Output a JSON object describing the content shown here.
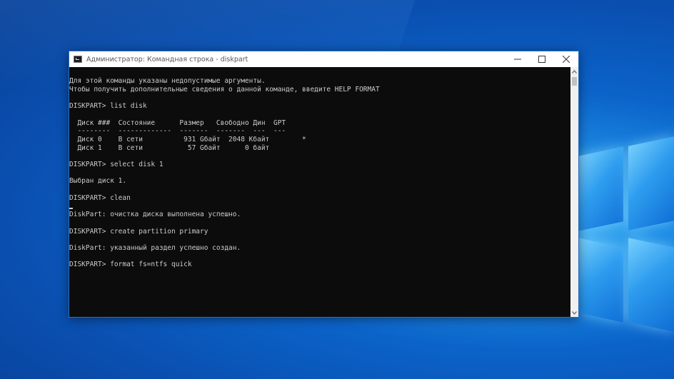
{
  "window": {
    "title": "Администратор: Командная строка - diskpart",
    "controls": {
      "minimize": "minimize-icon",
      "maximize": "maximize-icon",
      "close": "close-icon"
    }
  },
  "console": {
    "lines": [
      "Для этой команды указаны недопустимые аргументы.",
      "Чтобы получить дополнительные сведения о данной команде, введите HELP FORMAT",
      "",
      "DISKPART> list disk",
      "",
      "  Диск ###  Состояние      Размер   Свободно Дин  GPT",
      "  --------  -------------  -------  -------  ---  ---",
      "  Диск 0    В сети          931 Gбайт  2048 Kбайт        *",
      "  Диск 1    В сети           57 Gбайт      0 байт",
      "",
      "DISKPART> select disk 1",
      "",
      "Выбран диск 1.",
      "",
      "DISKPART> clean",
      "",
      "DiskPart: очистка диска выполнена успешно.",
      "",
      "DISKPART> create partition primary",
      "",
      "DiskPart: указанный раздел успешно создан.",
      "",
      "DISKPART> format fs=ntfs quick"
    ]
  }
}
